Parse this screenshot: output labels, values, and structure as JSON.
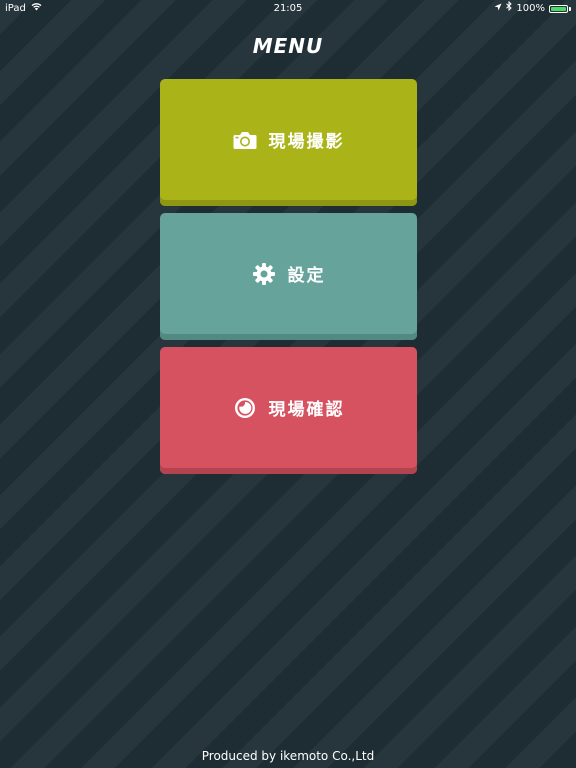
{
  "status_bar": {
    "device": "iPad",
    "time": "21:05",
    "battery_percent_label": "100%",
    "battery_level": 1.0,
    "icons": [
      "wifi-icon",
      "location-arrow-icon",
      "bluetooth-icon",
      "battery-icon"
    ],
    "battery_color": "#4cd964"
  },
  "header": {
    "title": "MENU"
  },
  "menu": {
    "items": [
      {
        "label": "現場撮影",
        "icon": "camera-icon",
        "color": "#aab419"
      },
      {
        "label": "設定",
        "icon": "gear-icon",
        "color": "#66a39a"
      },
      {
        "label": "現場確認",
        "icon": "circle-check-icon",
        "color": "#d65260"
      }
    ]
  },
  "footer": {
    "credit": "Produced by ikemoto Co.,Ltd"
  },
  "colors": {
    "background": "#1d2d33",
    "stripe": "#26363c",
    "text": "#ffffff"
  }
}
